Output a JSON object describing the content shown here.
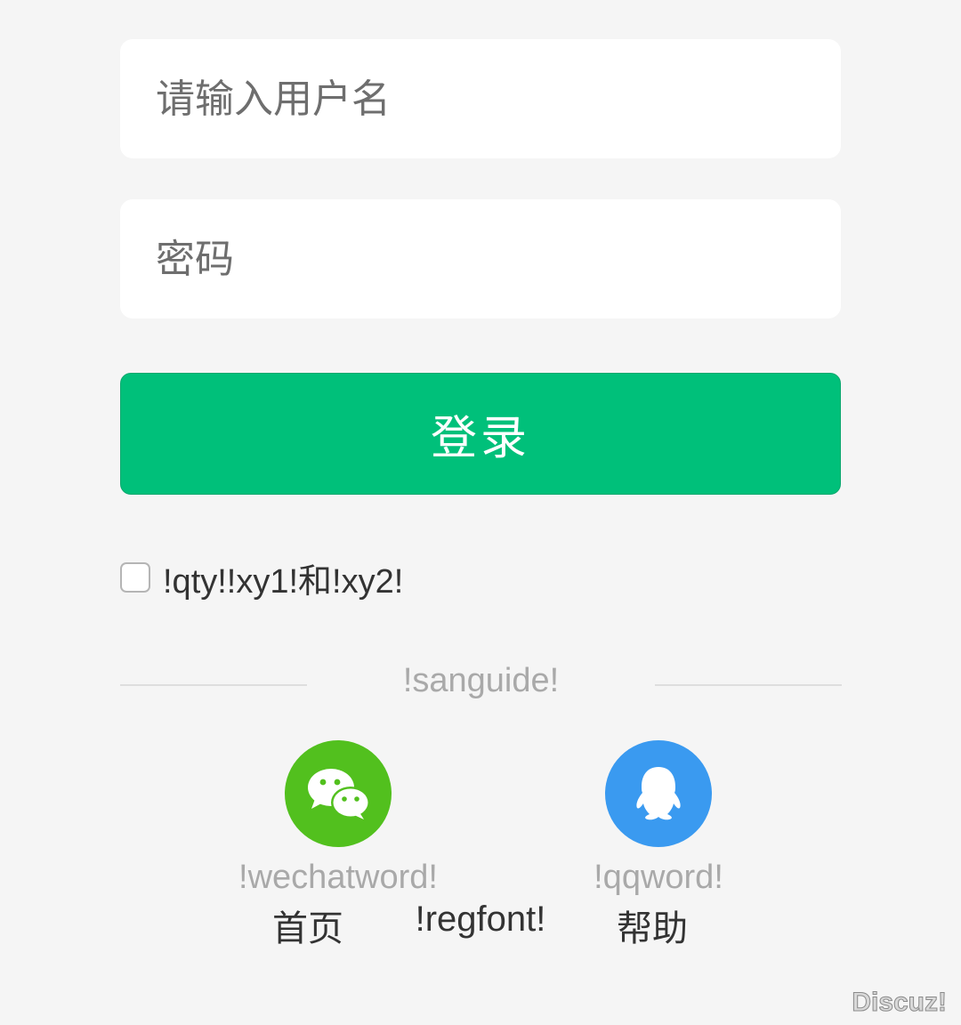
{
  "form": {
    "username_placeholder": "请输入用户名",
    "password_placeholder": "密码",
    "login_label": "登录",
    "agree_text": "!qty!!xy1!和!xy2!",
    "agree_checked": false
  },
  "social": {
    "divider_text": "!sanguide!",
    "wechat_label": "!wechatword!",
    "qq_label": "!qqword!",
    "wechat_icon": "wechat-icon",
    "qq_icon": "qq-icon"
  },
  "footer": {
    "home": "首页",
    "register": "!regfont!",
    "help": "帮助"
  },
  "watermark": "Discuz!",
  "colors": {
    "accent": "#00c07a",
    "wechat": "#52c01e",
    "qq": "#3a9af0",
    "background": "#f5f5f5"
  }
}
